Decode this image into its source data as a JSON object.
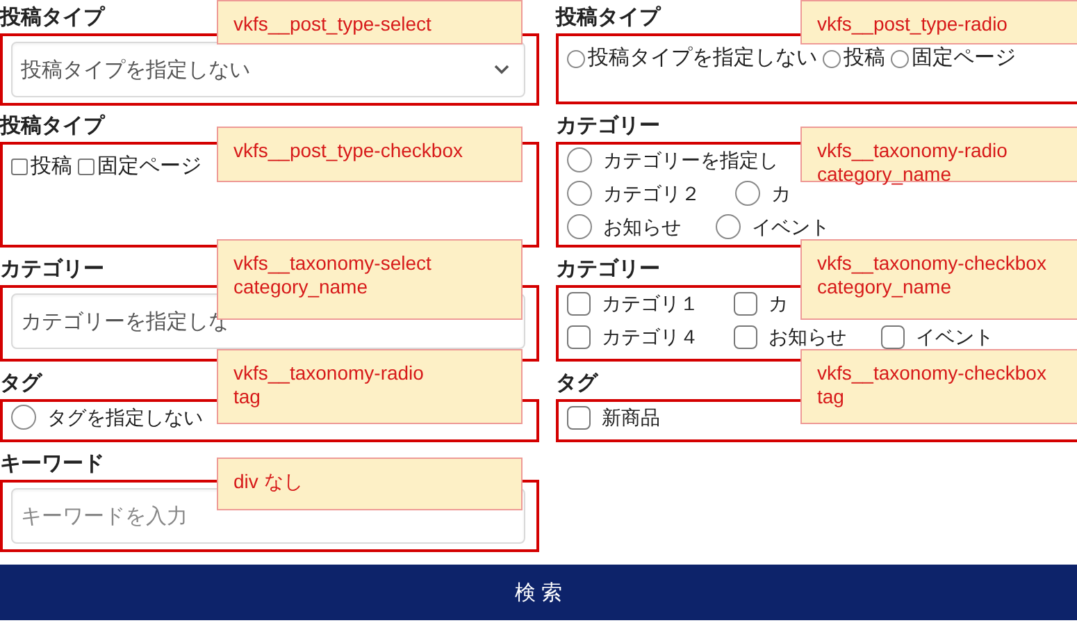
{
  "left_column": [
    {
      "label": "投稿タイプ",
      "kind": "select",
      "value": "投稿タイプを指定しない",
      "arrow": true
    },
    {
      "label": "投稿タイプ",
      "kind": "checkbox_group",
      "compact": true,
      "rows": [
        [
          {
            "label": "投稿",
            "checked": false
          },
          {
            "label": "固定ページ",
            "checked": false
          }
        ]
      ]
    },
    {
      "label": "カテゴリー",
      "kind": "select",
      "value": "カテゴリーを指定しな"
    },
    {
      "label": "タグ",
      "kind": "radio_group",
      "compact": false,
      "rows": [
        [
          {
            "label": "タグを指定しない",
            "selected": false
          }
        ]
      ]
    },
    {
      "label": "キーワード",
      "kind": "input",
      "placeholder": "キーワードを入力"
    }
  ],
  "right_column": [
    {
      "label": "投稿タイプ",
      "kind": "radio_group",
      "compact": true,
      "rows": [
        [
          {
            "label": "投稿タイプを指定しない",
            "selected": false
          },
          {
            "label": "投稿",
            "selected": false
          },
          {
            "label": "固定ページ",
            "selected": false
          }
        ]
      ]
    },
    {
      "label": "カテゴリー",
      "kind": "radio_group",
      "compact": false,
      "rows": [
        [
          {
            "label": "カテゴリーを指定し",
            "selected": false
          }
        ],
        [
          {
            "label": "カテゴリ２",
            "selected": false
          },
          {
            "label": "カ",
            "selected": false
          }
        ],
        [
          {
            "label": "お知らせ",
            "selected": false
          },
          {
            "label": "イベント",
            "selected": false
          }
        ]
      ]
    },
    {
      "label": "カテゴリー",
      "kind": "checkbox_group",
      "compact": false,
      "rows": [
        [
          {
            "label": "カテゴリ１",
            "checked": false
          },
          {
            "label": "カ",
            "checked": false
          }
        ],
        [
          {
            "label": "カテゴリ４",
            "checked": false
          },
          {
            "label": "お知らせ",
            "checked": false
          },
          {
            "label": "イベント",
            "checked": false
          }
        ]
      ]
    },
    {
      "label": "タグ",
      "kind": "checkbox_group",
      "compact": false,
      "rows": [
        [
          {
            "label": "新商品",
            "checked": false
          }
        ]
      ]
    }
  ],
  "search_button": "検 索",
  "left_notes": [
    "vkfs__post_type-select",
    "vkfs__post_type-checkbox",
    "vkfs__taxonomy-select\ncategory_name",
    "vkfs__taxonomy-radio\ntag",
    "div なし"
  ],
  "right_notes": [
    "vkfs__post_type-radio",
    "vkfs__taxonomy-radio\ncategory_name",
    "vkfs__taxonomy-checkbox\ncategory_name",
    "vkfs__taxonomy-checkbox\ntag"
  ]
}
